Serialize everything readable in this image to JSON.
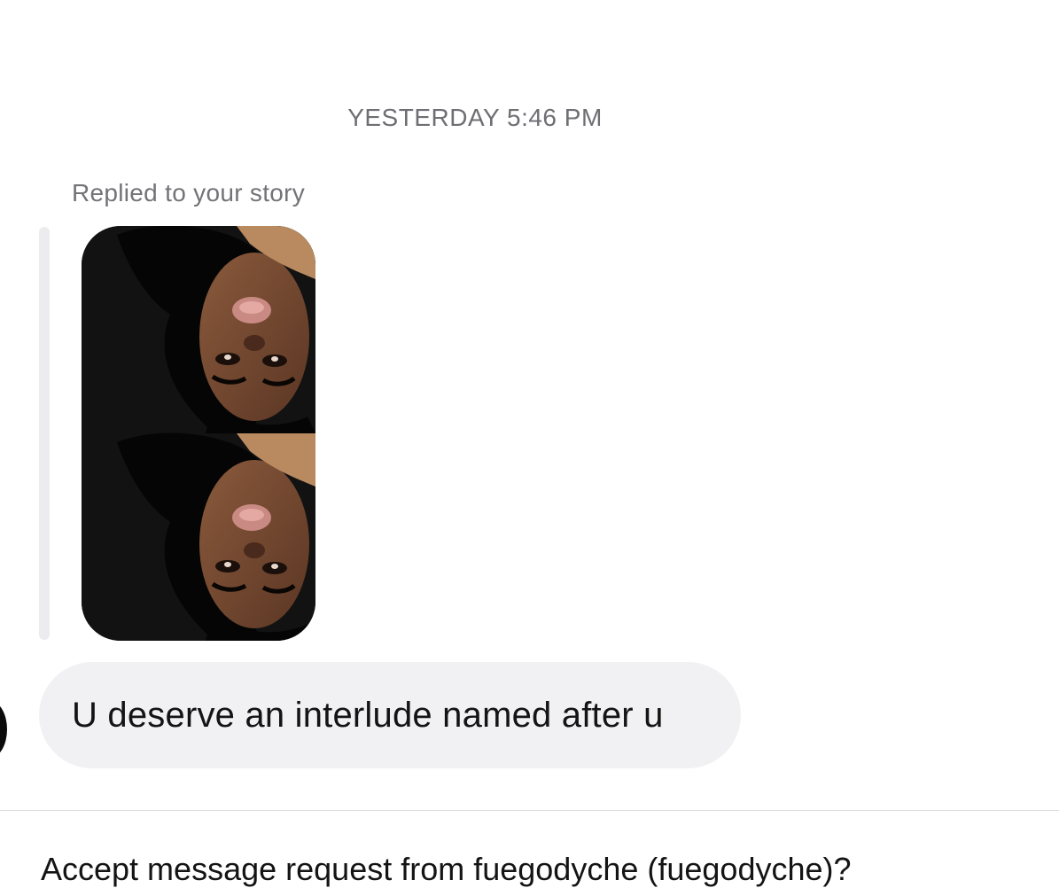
{
  "thread": {
    "timestamp": "YESTERDAY 5:46 PM",
    "story_reply": {
      "label": "Replied to your story"
    },
    "message": {
      "text": "U deserve an interlude named after u"
    }
  },
  "request_prompt": {
    "text": "Accept message request from fuegodyche (fuegodyche)?"
  },
  "colors": {
    "bubble_background": "#f1f1f3",
    "meta_text": "#6e6e73",
    "message_text": "#141414"
  }
}
